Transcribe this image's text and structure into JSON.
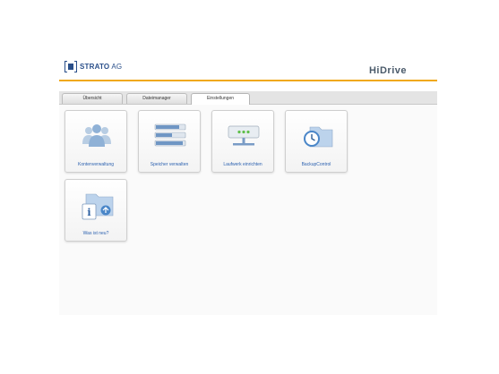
{
  "header": {
    "logo_text_bold": "STRATO",
    "logo_text_rest": " AG",
    "product_name": "HiDrive"
  },
  "tabs": [
    {
      "label": "Übersicht"
    },
    {
      "label": "Dateimanager"
    },
    {
      "label": "Einstellungen",
      "active": true
    }
  ],
  "tiles": [
    {
      "label": "Kontenverwaltung",
      "icon": "users-icon"
    },
    {
      "label": "Speicher verwalten",
      "icon": "storage-icon"
    },
    {
      "label": "Laufwerk einrichten",
      "icon": "network-drive-icon"
    },
    {
      "label": "BackupControl",
      "icon": "backup-clock-icon"
    },
    {
      "label": "Was ist neu?",
      "icon": "info-folder-icon"
    }
  ],
  "colors": {
    "accent": "#f0a818",
    "brand": "#2a4f8a",
    "link": "#2d62b0"
  }
}
